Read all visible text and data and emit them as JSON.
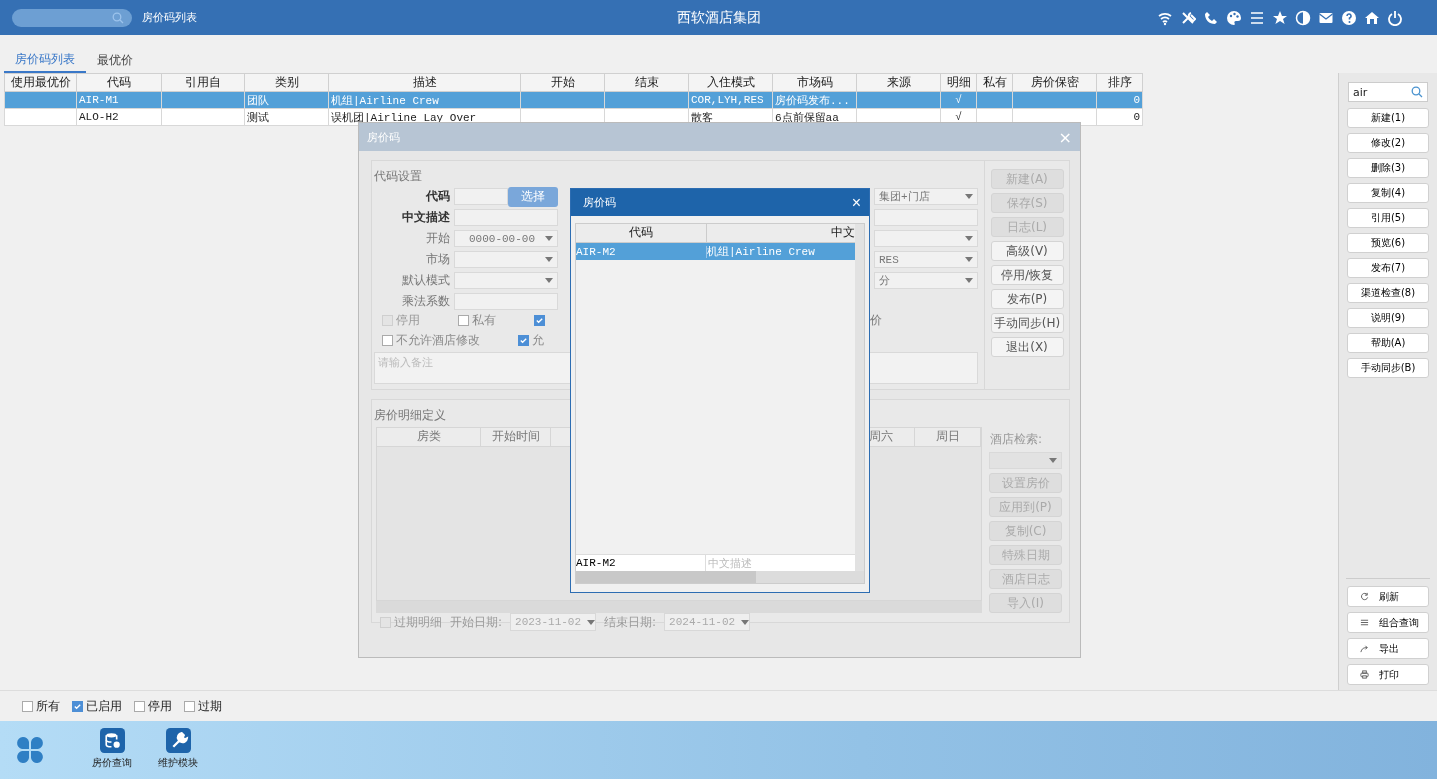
{
  "header": {
    "breadcrumb": "房价码列表",
    "title": "西软酒店集团"
  },
  "tabs": [
    {
      "label": "房价码列表",
      "selected": true
    },
    {
      "label": "最优价",
      "selected": false
    }
  ],
  "table": {
    "columns": [
      "使用最优价",
      "代码",
      "引用自",
      "类别",
      "描述",
      "开始",
      "结束",
      "入住模式",
      "市场码",
      "来源",
      "明细",
      "私有",
      "房价保密",
      "排序"
    ],
    "rows": [
      {
        "selected": true,
        "cells": [
          "",
          "AIR-M1",
          "",
          "团队",
          "机组|Airline Crew",
          "",
          "",
          "COR,LYH,RES",
          "房价码发布...",
          "",
          "√",
          "",
          "",
          "0"
        ]
      },
      {
        "selected": false,
        "cells": [
          "",
          "ALO-H2",
          "",
          "测试",
          "误机团|Airline Lay Over",
          "",
          "",
          "散客",
          "6点前保留aa",
          "",
          "√",
          "",
          "",
          "0"
        ]
      }
    ]
  },
  "dialog": {
    "title": "房价码",
    "close": "×",
    "code_section": {
      "title": "代码设置",
      "fields": [
        {
          "label": "代码",
          "kind": "code",
          "button": "选择"
        },
        {
          "label": "中文描述",
          "kind": "input"
        },
        {
          "label": "开始",
          "kind": "select",
          "value": "0000-00-00"
        },
        {
          "label": "市场",
          "kind": "select"
        },
        {
          "label": "默认模式",
          "kind": "select"
        },
        {
          "label": "乘法系数",
          "kind": "input"
        }
      ],
      "right_fields": [
        {
          "kind": "select",
          "value": "集团+门店"
        },
        {
          "kind": "input"
        },
        {
          "kind": "select"
        },
        {
          "kind": "select",
          "value": "RES"
        },
        {
          "kind": "select",
          "value": "分"
        }
      ],
      "checkboxes_row1": [
        {
          "label": "停用",
          "checked": false,
          "disabled": true
        },
        {
          "label": "私有",
          "checked": false,
          "disabled": false
        },
        {
          "checked": true,
          "disabled": false
        }
      ],
      "row1_tail": "价",
      "checkboxes_row2": [
        {
          "label": "不允许酒店修改",
          "checked": false,
          "disabled": false
        },
        {
          "label": "允",
          "checked": true,
          "disabled": false
        }
      ],
      "remark": {
        "placeholder": "请输入备注"
      },
      "buttons": [
        {
          "label": "新建(A)",
          "disabled": true
        },
        {
          "label": "保存(S)",
          "disabled": true
        },
        {
          "label": "日志(L)",
          "disabled": true
        },
        {
          "label": "高级(V)",
          "disabled": false
        },
        {
          "label": "停用/恢复",
          "disabled": false
        },
        {
          "label": "发布(P)",
          "disabled": false
        },
        {
          "label": "手动同步(H)",
          "disabled": false
        },
        {
          "label": "退出(X)",
          "disabled": false
        }
      ]
    },
    "detail_section": {
      "title": "房价明细定义",
      "columns": [
        "房类",
        "开始时间",
        "周六",
        "周日"
      ],
      "hotel_search_label": "酒店检索:",
      "buttons": [
        {
          "label": "设置房价",
          "disabled": true
        },
        {
          "label": "应用到(P)",
          "disabled": true
        },
        {
          "label": "复制(C)",
          "disabled": true
        },
        {
          "label": "特殊日期",
          "disabled": true
        },
        {
          "label": "酒店日志",
          "disabled": true
        },
        {
          "label": "导入(I)",
          "disabled": true
        }
      ],
      "expired": {
        "label": "过期明细",
        "checked": false,
        "disabled": true
      },
      "start_label": "开始日期:",
      "start_date": "2023-11-02",
      "end_label": "结束日期:",
      "end_date": "2024-11-02"
    }
  },
  "popup": {
    "title": "房价码",
    "close": "×",
    "columns": [
      "代码",
      "中文"
    ],
    "rows": [
      {
        "selected": true,
        "cells": [
          "AIR-M2",
          "机组|Airline Crew"
        ]
      }
    ],
    "filter": {
      "code_value": "AIR-M2",
      "desc_placeholder": "中文描述"
    }
  },
  "sidebar": {
    "search": "air",
    "buttons": [
      "新建(1)",
      "修改(2)",
      "删除(3)",
      "复制(4)",
      "引用(5)",
      "预览(6)",
      "发布(7)",
      "渠道检查(8)",
      "说明(9)",
      "帮助(A)",
      "手动同步(B)"
    ],
    "actions": [
      {
        "kind": "refresh",
        "label": "刷新"
      },
      {
        "kind": "query",
        "label": "组合查询"
      },
      {
        "kind": "export",
        "label": "导出"
      },
      {
        "kind": "print",
        "label": "打印"
      }
    ]
  },
  "filters": [
    {
      "label": "所有",
      "checked": false
    },
    {
      "label": "已启用",
      "checked": true
    },
    {
      "label": "停用",
      "checked": false
    },
    {
      "label": "过期",
      "checked": false
    }
  ],
  "taskbar": [
    {
      "kind": "database",
      "label": "房价查询"
    },
    {
      "kind": "wrench",
      "label": "维护模块"
    }
  ]
}
